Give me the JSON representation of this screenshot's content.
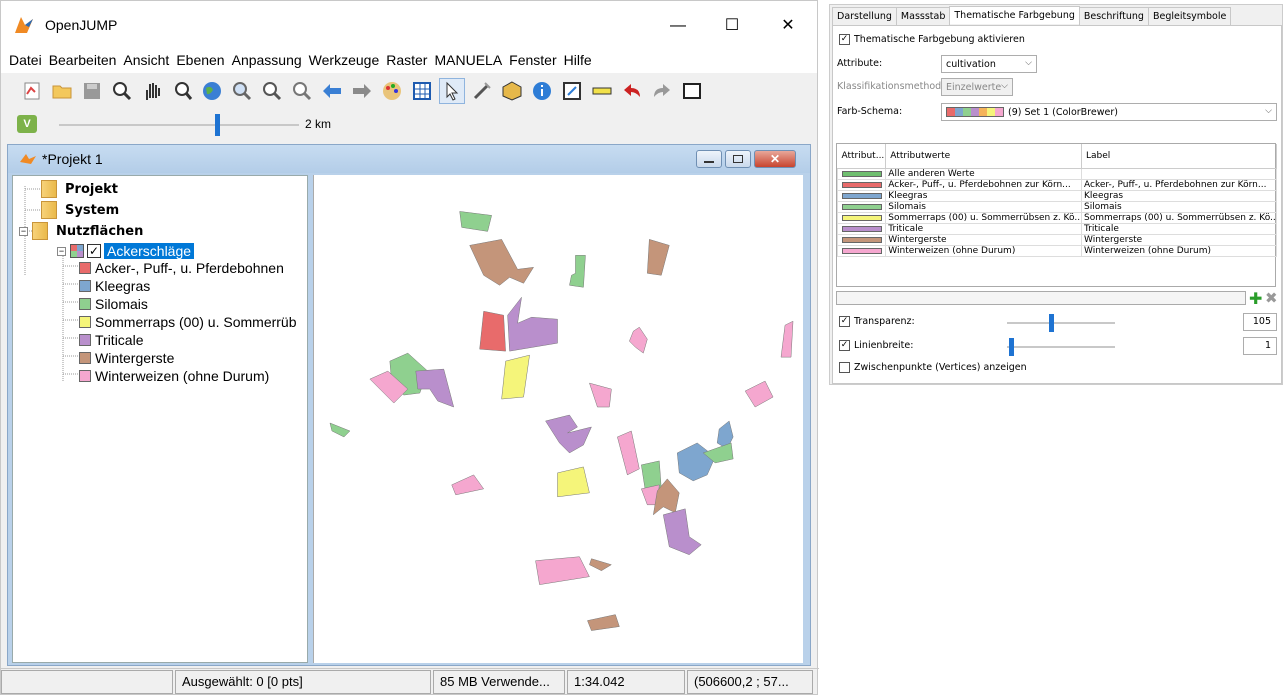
{
  "window": {
    "title": "OpenJUMP",
    "menu": [
      "Datei",
      "Bearbeiten",
      "Ansicht",
      "Ebenen",
      "Anpassung",
      "Werkzeuge",
      "Raster",
      "MANUELA",
      "Fenster",
      "Hilfe"
    ]
  },
  "toolbar": {
    "icons": [
      "new-project-icon",
      "open-folder-icon",
      "save-icon",
      "zoom-icon",
      "pan-hand-icon",
      "zoom-previous-icon",
      "globe-icon",
      "zoom-extent-icon",
      "zoom-in-icon",
      "zoom-out-icon",
      "previous-view-icon",
      "next-view-icon",
      "palette-icon",
      "grid-icon",
      "select-arrow-icon",
      "edit-wand-icon",
      "cube-icon",
      "info-icon",
      "edit-form-icon",
      "ruler-icon",
      "undo-icon",
      "redo-icon",
      "fullscreen-icon"
    ]
  },
  "scale": {
    "label": "2 km",
    "slider_fraction": 0.65
  },
  "project": {
    "title": "*Projekt 1",
    "tree": {
      "categories": [
        {
          "label": "Projekt"
        },
        {
          "label": "System"
        },
        {
          "label": "Nutzflächen"
        }
      ],
      "layer": {
        "label": "Ackerschläge",
        "checked": true
      },
      "legend": [
        {
          "label": "Acker-, Puff-, u. Pferdebohnen",
          "color": "#e86b6b"
        },
        {
          "label": "Kleegras",
          "color": "#7ea6cf"
        },
        {
          "label": "Silomais",
          "color": "#8fd08f"
        },
        {
          "label": "Sommerraps (00) u. Sommerrüb",
          "color": "#f5f57a"
        },
        {
          "label": "Triticale",
          "color": "#b98fcc"
        },
        {
          "label": "Wintergerste",
          "color": "#c4957a"
        },
        {
          "label": "Winterweizen (ohne Durum)",
          "color": "#f5a7cf"
        }
      ]
    }
  },
  "status": {
    "selected": "Ausgewählt: 0 [0 pts]",
    "memory": "85 MB Verwende...",
    "scale": "1:34.042",
    "coords": "(506600,2 ; 57..."
  },
  "dialog": {
    "tabs": [
      "Darstellung",
      "Massstab",
      "Thematische Farbgebung",
      "Beschriftung",
      "Begleitsymbole"
    ],
    "active_tab": "Thematische Farbgebung",
    "enable_label": "Thematische Farbgebung aktivieren",
    "enable_checked": true,
    "attribute_label": "Attribute:",
    "attribute_value": "cultivation",
    "method_label": "Klassifikationsmethode:",
    "method_value": "Einzelwerte",
    "scheme_label": "Farb-Schema:",
    "scheme_value": "(9) Set 1 (ColorBrewer)",
    "table_headers": [
      "Attribut...",
      "Attributwerte",
      "Label"
    ],
    "rows": [
      {
        "color": "#6fbf6f",
        "value": "Alle anderen Werte",
        "label": ""
      },
      {
        "color": "#e86b6b",
        "value": "Acker-, Puff-, u. Pferdebohnen zur Körn...",
        "label": "Acker-, Puff-, u. Pferdebohnen zur Körn..."
      },
      {
        "color": "#7ea6cf",
        "value": "Kleegras",
        "label": "Kleegras"
      },
      {
        "color": "#8fd08f",
        "value": "Silomais",
        "label": "Silomais"
      },
      {
        "color": "#f5f57a",
        "value": "Sommerraps (00) u. Sommerrübsen z. Kö...",
        "label": "Sommerraps (00) u. Sommerrübsen z. Kö..."
      },
      {
        "color": "#b98fcc",
        "value": "Triticale",
        "label": "Triticale"
      },
      {
        "color": "#c4957a",
        "value": "Wintergerste",
        "label": "Wintergerste"
      },
      {
        "color": "#f5a7cf",
        "value": "Winterweizen (ohne Durum)",
        "label": "Winterweizen (ohne Durum)"
      }
    ],
    "transparency_label": "Transparenz:",
    "transparency_value": "105",
    "linewidth_label": "Linienbreite:",
    "linewidth_value": "1",
    "vertices_label": "Zwischenpunkte (Vertices) anzeigen",
    "vertices_checked": false
  },
  "colors": {
    "selection": "#0078d7",
    "slider": "#1e73d2"
  }
}
